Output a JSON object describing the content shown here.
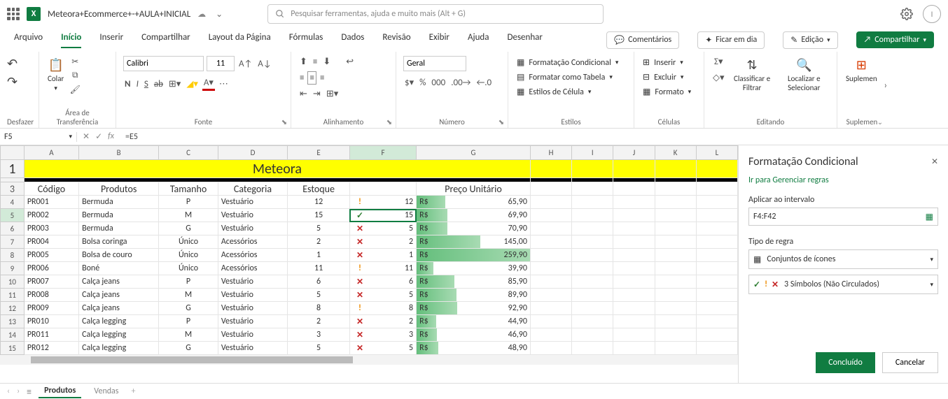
{
  "title": {
    "fileName": "Meteora+Ecommerce+-+AULA+INICIAL",
    "searchPlaceholder": "Pesquisar ferramentas, ajuda e muito mais (Alt + G)",
    "profileInitial": "I"
  },
  "menu": {
    "tabs": [
      "Arquivo",
      "Início",
      "Inserir",
      "Compartilhar",
      "Layout da Página",
      "Fórmulas",
      "Dados",
      "Revisão",
      "Exibir",
      "Ajuda",
      "Desenhar"
    ],
    "active": 1,
    "btnComments": "Comentários",
    "btnCatchUp": "Ficar em dia",
    "btnEdit": "Edição",
    "btnShare": "Compartilhar"
  },
  "ribbon": {
    "undoLabel": "Desfazer",
    "clipLabel": "Área de Transferência",
    "paste": "Colar",
    "fontLabel": "Fonte",
    "fontName": "Calibri",
    "fontSize": "11",
    "alignLabel": "Alinhamento",
    "numLabel": "Número",
    "numFormat": "Geral",
    "stylesLabel": "Estilos",
    "condFormat": "Formatação Condicional",
    "asTable": "Formatar como Tabela",
    "cellStyles": "Estilos de Célula",
    "cellsLabel": "Células",
    "insert": "Inserir",
    "delete": "Excluir",
    "format": "Formato",
    "editLabel": "Editando",
    "sortFilter": "Classificar e Filtrar",
    "findSelect": "Localizar e Selecionar",
    "addinsLabel": "Suplemen",
    "addins": "Suplemen"
  },
  "formula": {
    "nameBox": "F5",
    "fx": "fx",
    "formula": "=E5"
  },
  "columns": [
    "A",
    "B",
    "C",
    "D",
    "E",
    "F",
    "G",
    "H",
    "I",
    "J",
    "K",
    "L"
  ],
  "sheet": {
    "title": "Meteora",
    "headers": [
      "Código",
      "Produtos",
      "Tamanho",
      "Categoria",
      "Estoque",
      "",
      "Preço Unitário"
    ],
    "maxPriceBar": 259.9,
    "rows": [
      {
        "r": 4,
        "code": "PR001",
        "prod": "Bermuda",
        "size": "P",
        "cat": "Vestuário",
        "stock": 12,
        "icon": "yellow",
        "price": "65,90",
        "bar": 65.9
      },
      {
        "r": 5,
        "code": "PR002",
        "prod": "Bermuda",
        "size": "M",
        "cat": "Vestuário",
        "stock": 15,
        "icon": "green",
        "price": "69,90",
        "bar": 69.9,
        "active": true
      },
      {
        "r": 6,
        "code": "PR003",
        "prod": "Bermuda",
        "size": "G",
        "cat": "Vestuário",
        "stock": 5,
        "icon": "red",
        "price": "70,90",
        "bar": 70.9
      },
      {
        "r": 7,
        "code": "PR004",
        "prod": "Bolsa coringa",
        "size": "Único",
        "cat": "Acessórios",
        "stock": 2,
        "icon": "red",
        "price": "145,00",
        "bar": 145.0
      },
      {
        "r": 8,
        "code": "PR005",
        "prod": "Bolsa de couro",
        "size": "Único",
        "cat": "Acessórios",
        "stock": 1,
        "icon": "red",
        "price": "259,90",
        "bar": 259.9
      },
      {
        "r": 9,
        "code": "PR006",
        "prod": "Boné",
        "size": "Único",
        "cat": "Acessórios",
        "stock": 11,
        "icon": "yellow",
        "price": "39,90",
        "bar": 39.9
      },
      {
        "r": 10,
        "code": "PR007",
        "prod": "Calça jeans",
        "size": "P",
        "cat": "Vestuário",
        "stock": 6,
        "icon": "red",
        "price": "85,90",
        "bar": 85.9
      },
      {
        "r": 11,
        "code": "PR008",
        "prod": "Calça jeans",
        "size": "M",
        "cat": "Vestuário",
        "stock": 5,
        "icon": "red",
        "price": "89,90",
        "bar": 89.9
      },
      {
        "r": 12,
        "code": "PR009",
        "prod": "Calça jeans",
        "size": "G",
        "cat": "Vestuário",
        "stock": 8,
        "icon": "yellow",
        "price": "92,90",
        "bar": 92.9
      },
      {
        "r": 13,
        "code": "PR010",
        "prod": "Calça legging",
        "size": "P",
        "cat": "Vestuário",
        "stock": 2,
        "icon": "red",
        "price": "44,90",
        "bar": 44.9
      },
      {
        "r": 14,
        "code": "PR011",
        "prod": "Calça legging",
        "size": "M",
        "cat": "Vestuário",
        "stock": 3,
        "icon": "red",
        "price": "46,90",
        "bar": 46.9
      },
      {
        "r": 15,
        "code": "PR012",
        "prod": "Calça legging",
        "size": "G",
        "cat": "Vestuário",
        "stock": 5,
        "icon": "red",
        "price": "48,90",
        "bar": 48.9
      }
    ]
  },
  "panel": {
    "title": "Formatação Condicional",
    "rulesLink": "Ir para Gerenciar regras",
    "applyLabel": "Aplicar ao intervalo",
    "range": "F4:F42",
    "ruleTypeLabel": "Tipo de regra",
    "ruleType": "Conjuntos de ícones",
    "iconStyle": "3 Símbolos (Não Circulados)",
    "done": "Concluído",
    "cancel": "Cancelar"
  },
  "tabs": {
    "sheet1": "Produtos",
    "sheet2": "Vendas"
  }
}
